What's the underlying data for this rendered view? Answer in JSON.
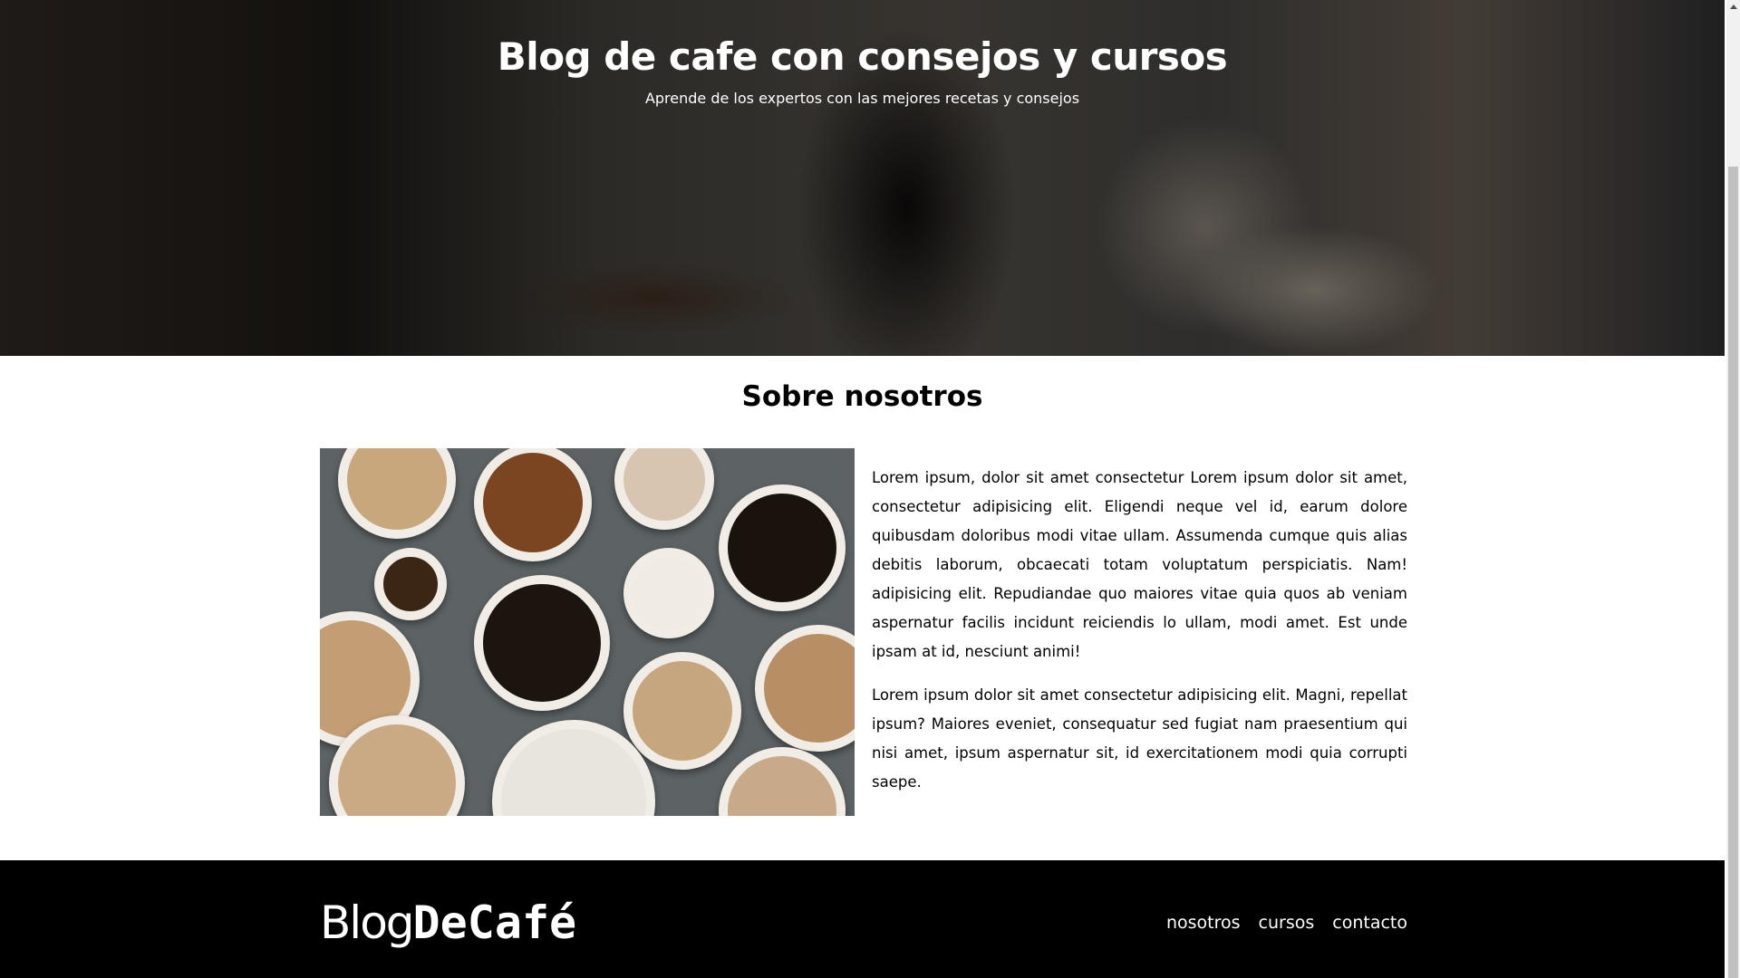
{
  "hero": {
    "title": "Blog de cafe con consejos y cursos",
    "subtitle": "Aprende de los expertos con las mejores recetas y consejos"
  },
  "about": {
    "title": "Sobre nosotros",
    "paragraphs": [
      "Lorem ipsum, dolor sit amet consectetur Lorem ipsum dolor sit amet, consectetur adipisicing elit. Eligendi neque vel id, earum dolore quibusdam doloribus modi vitae ullam. Assumenda cumque quis alias debitis laborum, obcaecati totam voluptatum perspiciatis. Nam! adipisicing elit. Repudiandae quo maiores vitae quia quos ab veniam aspernatur facilis incidunt reiciendis lo ullam, modi amet. Est unde ipsam at id, nesciunt animi!",
      "Lorem ipsum dolor sit amet consectetur adipisicing elit. Magni, repellat ipsum? Maiores eveniet, consequatur sed fugiat nam praesentium qui nisi amet, ipsum aspernatur sit, id exercitationem modi quia corrupti saepe."
    ]
  },
  "footer": {
    "logo_light": "Blog",
    "logo_bold": "DeCafé",
    "nav": [
      {
        "label": "nosotros"
      },
      {
        "label": "cursos"
      },
      {
        "label": "contacto"
      }
    ]
  }
}
